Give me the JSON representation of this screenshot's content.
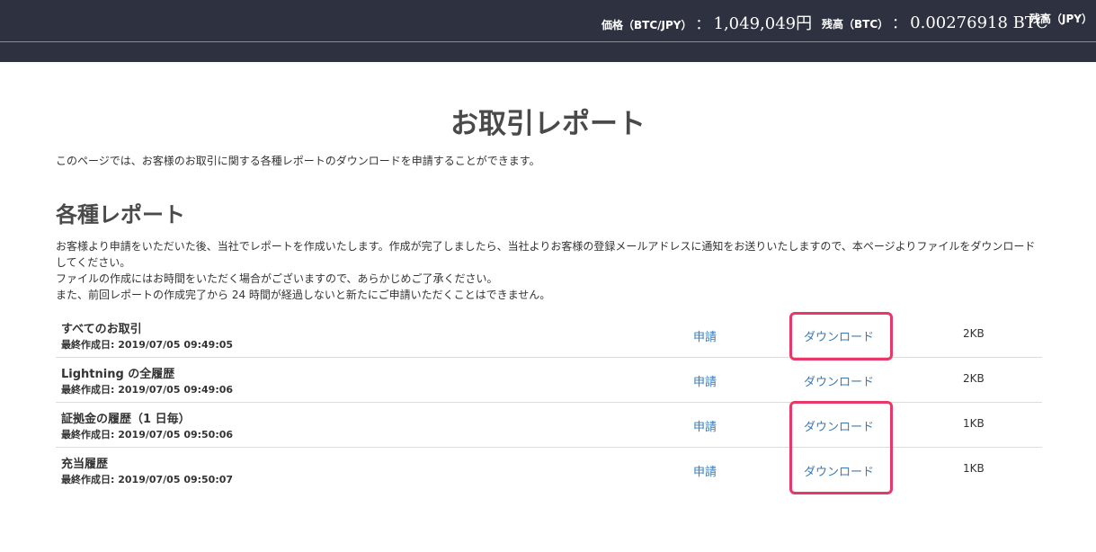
{
  "header": {
    "price_label": "価格（BTC/JPY）",
    "price_sep": "：",
    "price_value": "1,049,049円",
    "btc_label": "残高（BTC）",
    "btc_sep": "：",
    "btc_value": "0.00276918 BTC",
    "jpy_label": "残高（JPY）"
  },
  "page": {
    "title": "お取引レポート",
    "intro": "このページでは、お客様のお取引に関する各種レポートのダウンロードを申請することができます。"
  },
  "section": {
    "title": "各種レポート",
    "description": [
      "お客様より申請をいただいた後、当社でレポートを作成いたします。作成が完了しましたら、当社よりお客様の登録メールアドレスに通知をお送りいたしますので、本ページよりファイルをダウンロードしてください。",
      "ファイルの作成にはお時間をいただく場合がございますので、あらかじめご了承ください。",
      "また、前回レポートの作成完了から 24 時間が経過しないと新たにご申請いただくことはできません。"
    ]
  },
  "reports": [
    {
      "name": "すべてのお取引",
      "date": "最終作成日: 2019/07/05 09:49:05",
      "apply": "申請",
      "download": "ダウンロード",
      "size": "2KB"
    },
    {
      "name": "Lightning の全履歴",
      "date": "最終作成日: 2019/07/05 09:49:06",
      "apply": "申請",
      "download": "ダウンロード",
      "size": "2KB"
    },
    {
      "name": "証拠金の履歴（1 日毎）",
      "date": "最終作成日: 2019/07/05 09:50:06",
      "apply": "申請",
      "download": "ダウンロード",
      "size": "1KB"
    },
    {
      "name": "充当履歴",
      "date": "最終作成日: 2019/07/05 09:50:07",
      "apply": "申請",
      "download": "ダウンロード",
      "size": "1KB"
    }
  ],
  "colors": {
    "header_bg": "#2e3140",
    "link": "#3a7ab8",
    "highlight": "#e8386a"
  }
}
